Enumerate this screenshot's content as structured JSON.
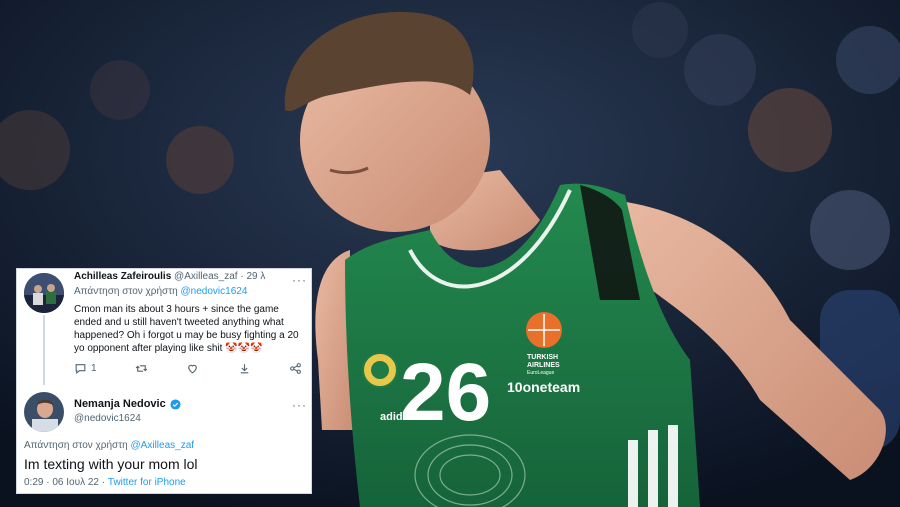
{
  "colors": {
    "jersey_green": "#1f7a45",
    "link_blue": "#1d9bf0",
    "text_dark": "#0f1419",
    "text_muted": "#536471"
  },
  "jersey": {
    "number": "26",
    "sponsor": "10oneteam",
    "sleeve_brand": "adidas",
    "badge_line1": "TURKISH",
    "badge_line2": "AIRLINES",
    "badge_line3": "EuroLeague"
  },
  "tweet1": {
    "author": "Achilleas Zafeiroulis",
    "handle": "@Axilleas_zaf",
    "separator": "·",
    "age": "29 λ",
    "replying_prefix": "Απάντηση στον χρήστη",
    "replying_to": "@nedovic1624",
    "body": "Cmon man its about 3 hours + since the game ended and u still haven't tweeted anything what happened? Oh i forgot u may be busy fighting a 20 yo opponent after playing like shit 🤡🤡🤡",
    "reply_count": "1",
    "more": "···"
  },
  "tweet2": {
    "author": "Nemanja Nedovic",
    "handle": "@nedovic1624",
    "replying_prefix": "Απάντηση στον χρήστη",
    "replying_to": "@Axilleas_zaf",
    "body": "Im texting with your mom lol",
    "time": "0:29",
    "dot": "·",
    "date": "06 Ιουλ 22",
    "source": "Twitter for iPhone",
    "more": "···"
  },
  "icons": [
    "reply-icon",
    "retweet-icon",
    "like-icon",
    "download-icon",
    "share-icon",
    "verified-badge-icon",
    "more-icon"
  ]
}
